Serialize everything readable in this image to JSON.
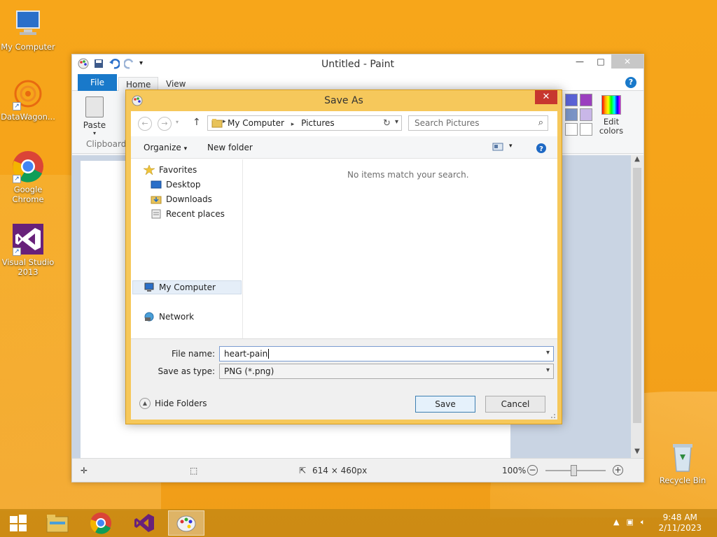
{
  "desktop": {
    "icons": [
      {
        "label": "My Computer"
      },
      {
        "label": "DataWagon..."
      },
      {
        "label": "Google Chrome"
      },
      {
        "label": "Visual Studio 2013"
      },
      {
        "label": "Recycle Bin"
      }
    ]
  },
  "paint": {
    "title": "Untitled - Paint",
    "tabs": {
      "file": "File",
      "home": "Home",
      "view": "View"
    },
    "ribbon": {
      "paste": "Paste",
      "clipboard": "Clipboard",
      "edit_colors": "Edit colors"
    },
    "palette_colors": [
      "#5b63d6",
      "#9b3fbf",
      "#7a94c6",
      "#c9b7e8",
      "#ffffff",
      "#ffffff"
    ],
    "status": {
      "size": "614 × 460px",
      "zoom": "100%"
    }
  },
  "dialog": {
    "title": "Save As",
    "address": {
      "crumb1": "My Computer",
      "crumb2": "Pictures"
    },
    "search_placeholder": "Search Pictures",
    "commands": {
      "organize": "Organize",
      "new_folder": "New folder"
    },
    "nav": {
      "favorites": "Favorites",
      "desktop": "Desktop",
      "downloads": "Downloads",
      "recent": "Recent places",
      "my_computer": "My Computer",
      "network": "Network"
    },
    "empty_message": "No items match your search.",
    "file_name_label": "File name:",
    "file_name_value": "heart-pain",
    "save_type_label": "Save as type:",
    "save_type_value": "PNG (*.png)",
    "hide_folders": "Hide Folders",
    "save": "Save",
    "cancel": "Cancel"
  },
  "taskbar": {
    "time": "9:48 AM",
    "date": "2/11/2023"
  }
}
